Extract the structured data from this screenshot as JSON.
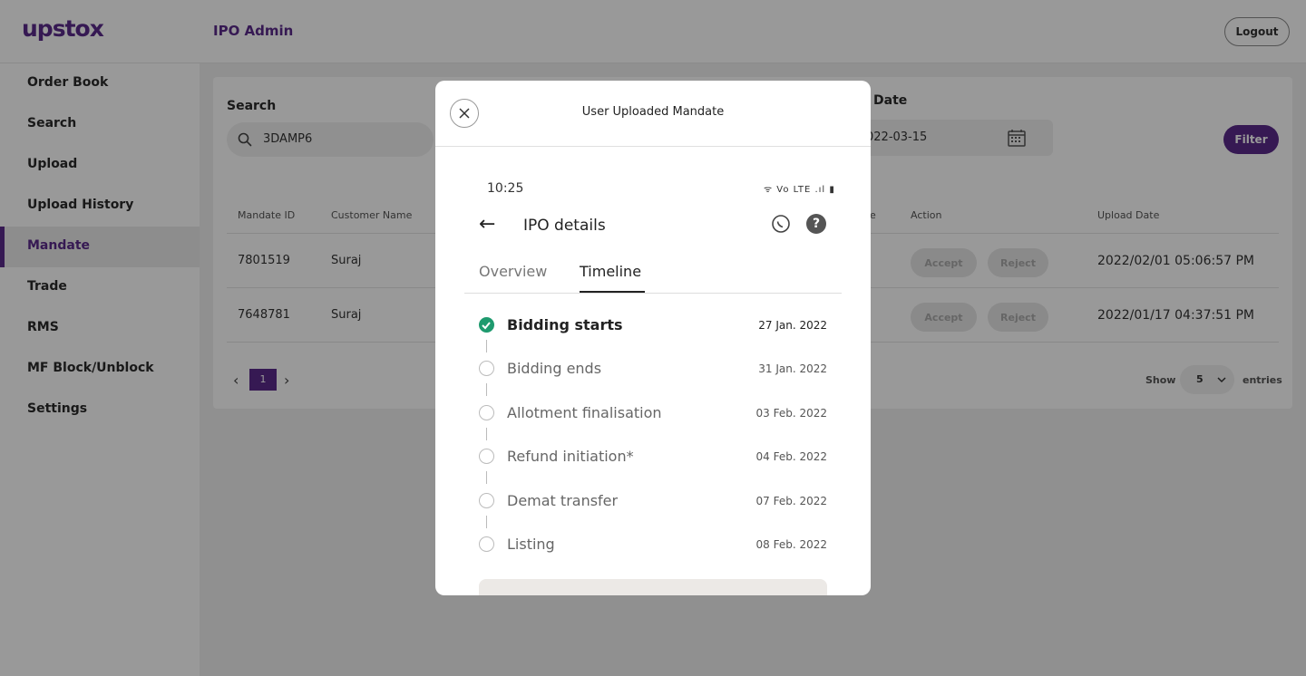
{
  "header": {
    "logo": "upstox",
    "app_title": "IPO Admin",
    "logout_label": "Logout"
  },
  "sidebar": {
    "items": [
      {
        "label": "Order Book"
      },
      {
        "label": "Search"
      },
      {
        "label": "Upload"
      },
      {
        "label": "Upload History"
      },
      {
        "label": "Mandate",
        "active": true
      },
      {
        "label": "Trade"
      },
      {
        "label": "RMS"
      },
      {
        "label": "MF Block/Unblock"
      },
      {
        "label": "Settings"
      }
    ]
  },
  "filters": {
    "search_label": "Search",
    "search_value": "3DAMP6",
    "date_label": "Date",
    "date_value": "022-03-15",
    "filter_label": "Filter"
  },
  "table": {
    "columns": [
      "Mandate ID",
      "Customer Name",
      "e",
      "Action",
      "Upload Date"
    ],
    "rows": [
      {
        "mandate_id": "7801519",
        "customer_name": "Suraj",
        "accept": "Accept",
        "reject": "Reject",
        "upload_date": "2022/02/01 05:06:57 PM"
      },
      {
        "mandate_id": "7648781",
        "customer_name": "Suraj",
        "accept": "Accept",
        "reject": "Reject",
        "upload_date": "2022/01/17 04:37:51 PM"
      }
    ]
  },
  "pagination": {
    "prev": "‹",
    "current_page": "1",
    "next": "›",
    "show_label": "Show",
    "page_size": "5",
    "entries_label": "entries"
  },
  "modal": {
    "title": "User Uploaded Mandate",
    "phone": {
      "time": "10:25",
      "status_icons": "ᯤ Vo LTE .ıl ▮",
      "screen_title": "IPO details",
      "tabs": [
        "Overview",
        "Timeline"
      ],
      "active_tab": "Timeline",
      "timeline": [
        {
          "label": "Bidding starts",
          "date": "27 Jan. 2022",
          "done": true
        },
        {
          "label": "Bidding ends",
          "date": "31 Jan. 2022",
          "done": false
        },
        {
          "label": "Allotment finalisation",
          "date": "03 Feb. 2022",
          "done": false
        },
        {
          "label": "Refund initiation*",
          "date": "04 Feb. 2022",
          "done": false
        },
        {
          "label": "Demat transfer",
          "date": "07 Feb. 2022",
          "done": false
        },
        {
          "label": "Listing",
          "date": "08 Feb. 2022",
          "done": false
        }
      ]
    }
  },
  "colors": {
    "brand": "#5a2a8a",
    "success": "#1e9a6e"
  }
}
